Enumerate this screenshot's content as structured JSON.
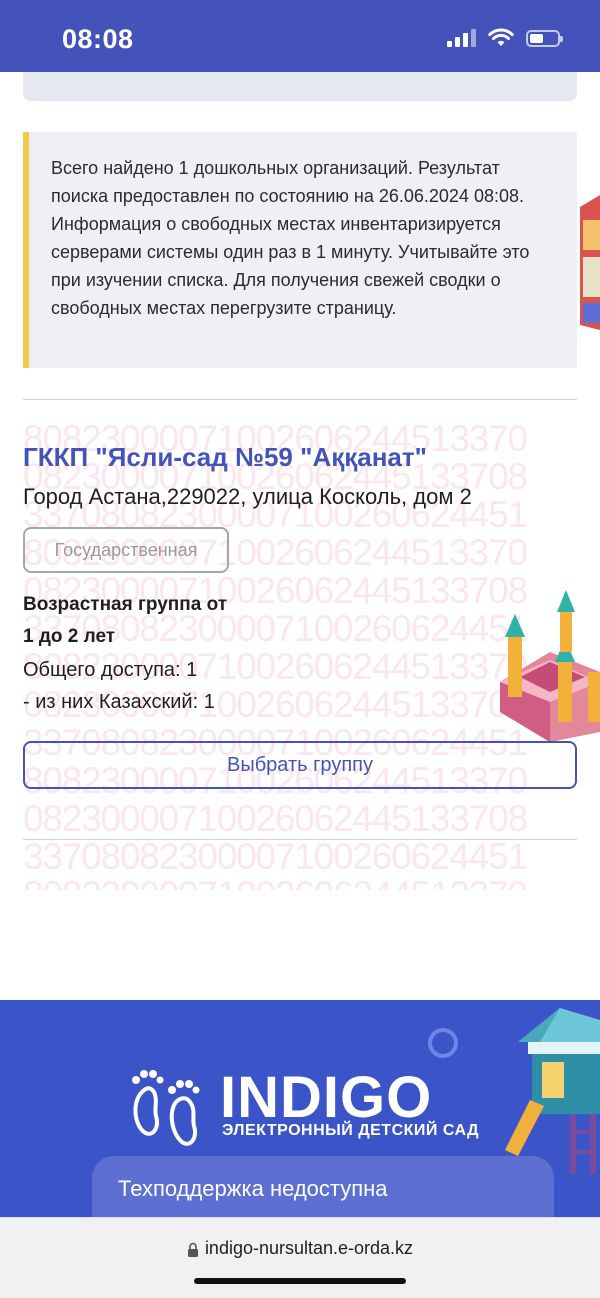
{
  "status_bar": {
    "time": "08:08"
  },
  "info": {
    "text": "Всего найдено 1 дошкольных организаций. Результат поиска предоставлен по состоянию на 26.06.2024 08:08. Информация о свободных местах инвентаризируется серверами системы один раз в 1 минуту. Учитывайте это при изучении списка. Для получения свежей сводки о свободных местах перегрузите страницу."
  },
  "kindergarten": {
    "name": "ГККП \"Ясли-сад №59 \"Аққанат\"",
    "address": "Город Астана,229022, улица Косколь, дом 2",
    "type": "Государственная",
    "age_group_title_1": "Возрастная группа от",
    "age_group_title_2": "1 до 2 лет",
    "general_access": "Общего доступа: 1",
    "kazakh": "- из них Казахский: 1",
    "select_button": "Выбрать группу",
    "watermark_lines": [
      "80823000071002606244513370",
      "08230000710026062445133708",
      "33708082300007100260624451",
      "80823000071002606244513370",
      "08230000710026062445133708",
      "33708082300007100260624451",
      "80823000071002606244513370",
      "08230000710026062445133708",
      "33708082300007100260624451",
      "80823000071002606244513370",
      "08230000710026062445133708",
      "33708082300007100260624451",
      "80823000071002606244513370"
    ]
  },
  "footer": {
    "logo_title": "INDIGO",
    "logo_subtitle": "ЭЛЕКТРОННЫЙ ДЕТСКИЙ САД",
    "support": "Техподдержка недоступна"
  },
  "browser": {
    "url": "indigo-nursultan.e-orda.kz"
  },
  "colors": {
    "brand": "#4353b9",
    "footer": "#3b55c9",
    "info_accent": "#f2c94c"
  }
}
